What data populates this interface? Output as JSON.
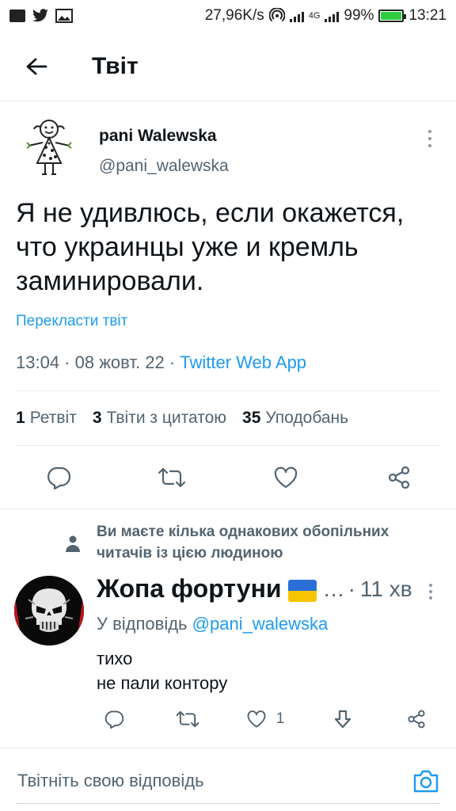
{
  "status_bar": {
    "speed": "27,96K/s",
    "network": "4G",
    "battery_percent": "99%",
    "battery_level": 0.99,
    "time": "13:21",
    "icons": [
      "flipboard-icon",
      "twitter-icon",
      "gallery-icon",
      "hotspot-icon",
      "signal-icon",
      "signal-4g-icon",
      "battery-icon"
    ]
  },
  "header": {
    "title": "Твіт",
    "back_icon": "arrow-left-icon"
  },
  "tweet": {
    "author_name": "pani Walewska",
    "author_handle": "@pani_walewska",
    "text": "Я не удивлюсь, если окажется, что украинцы уже и кремль заминировали.",
    "translate_label": "Перекласти твіт",
    "time": "13:04",
    "separator": " · ",
    "date": "08 жовт. 22",
    "app": "Twitter Web App",
    "stats": {
      "retweets_count": "1",
      "retweets_label": "Ретвіт",
      "quotes_count": "3",
      "quotes_label": "Твіти з цитатою",
      "likes_count": "35",
      "likes_label": "Уподобань"
    },
    "action_icons": [
      "reply-icon",
      "retweet-icon",
      "like-icon",
      "share-icon"
    ]
  },
  "reply": {
    "social_context": "Ви маєте кілька однакових обопільних читачів із цією людиною",
    "author_name": "Жопа фортуни",
    "ellipsis": "…",
    "dot": "·",
    "time": "11 хв",
    "reply_to_prefix": "У відповідь",
    "reply_to_handle": "@pani_walewska",
    "text_line1": "тихо",
    "text_line2": "не пали контору",
    "like_count": "1",
    "action_icons": [
      "reply-icon",
      "retweet-icon",
      "like-icon",
      "downvote-icon",
      "share-icon"
    ]
  },
  "composer": {
    "placeholder": "Твітніть свою відповідь",
    "camera_icon": "camera-icon"
  },
  "colors": {
    "accent": "#1d9bf0",
    "text": "#0f1419",
    "secondary": "#536471",
    "border": "#e6ecf0"
  }
}
